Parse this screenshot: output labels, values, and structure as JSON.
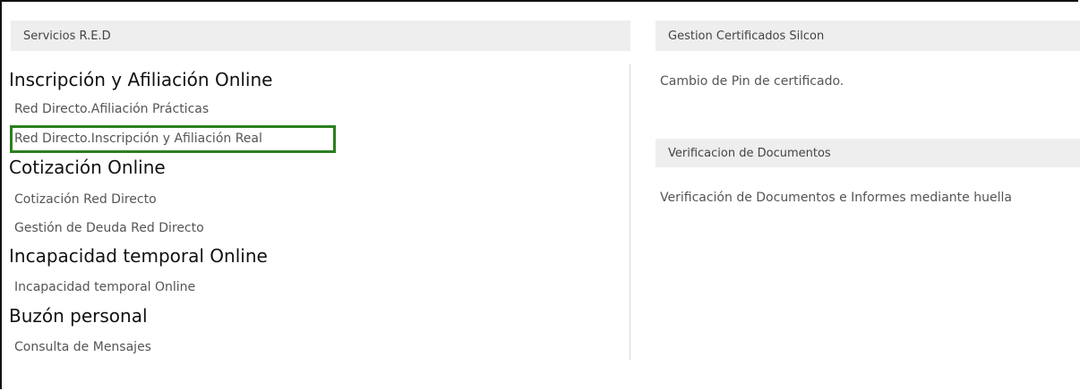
{
  "left_panel": {
    "header": "Servicios R.E.D",
    "sections": [
      {
        "title": "Inscripción y Afiliación Online",
        "links": [
          "Red Directo.Afiliación Prácticas",
          "Red Directo.Inscripción y Afiliación Real"
        ]
      },
      {
        "title": "Cotización Online",
        "links": [
          "Cotización Red Directo",
          "Gestión de Deuda Red Directo"
        ]
      },
      {
        "title": "Incapacidad temporal Online",
        "links": [
          "Incapacidad temporal Online"
        ]
      },
      {
        "title": "Buzón personal",
        "links": [
          "Consulta de Mensajes"
        ]
      }
    ]
  },
  "right_panel": {
    "certificados": {
      "header": "Gestion Certificados Silcon",
      "link": "Cambio de Pin de certificado."
    },
    "verificacion": {
      "header": "Verificacion de Documentos",
      "link": "Verificación de Documentos e Informes mediante huella"
    }
  },
  "colors": {
    "header_bg": "#eeeeee",
    "highlight": "#2a7f1f",
    "link": "#555555"
  }
}
